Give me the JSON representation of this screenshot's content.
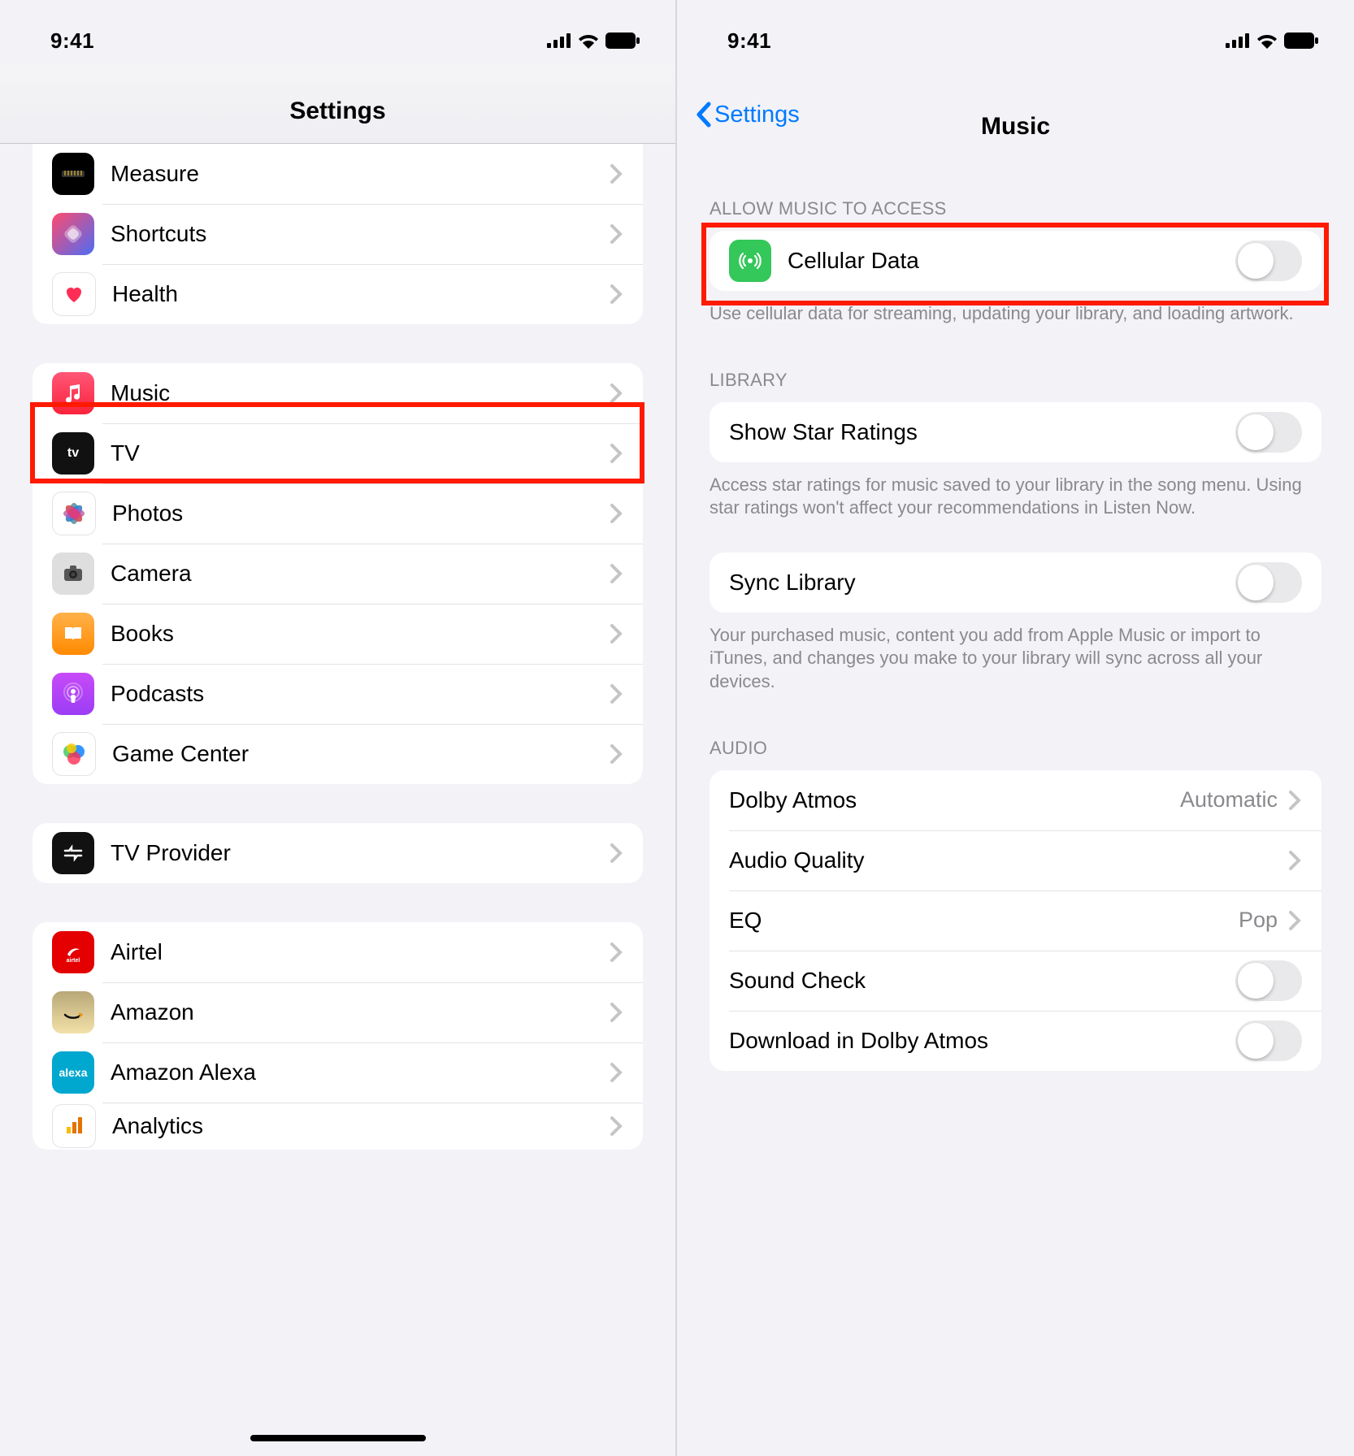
{
  "status": {
    "time": "9:41"
  },
  "left": {
    "title": "Settings",
    "group1": [
      {
        "id": "measure",
        "label": "Measure",
        "bg": "#111",
        "icon": "ruler"
      },
      {
        "id": "shortcuts",
        "label": "Shortcuts",
        "bg": "linear-gradient(135deg,#2a3fbf,#4d6cf5)",
        "icon": "shortcuts"
      },
      {
        "id": "health",
        "label": "Health",
        "bg": "#ffffff",
        "border": "#e3e3e6",
        "icon": "heart"
      }
    ],
    "group2": [
      {
        "id": "music",
        "label": "Music",
        "bg": "linear-gradient(#ff5777,#fa233b)",
        "icon": "music"
      },
      {
        "id": "tv",
        "label": "TV",
        "bg": "#111",
        "icon": "appletv"
      },
      {
        "id": "photos",
        "label": "Photos",
        "bg": "#ffffff",
        "border": "#e3e3e6",
        "icon": "photos"
      },
      {
        "id": "camera",
        "label": "Camera",
        "bg": "#9b9b9b",
        "icon": "camera"
      },
      {
        "id": "books",
        "label": "Books",
        "bg": "linear-gradient(#ffb14a,#ff8a00)",
        "icon": "books"
      },
      {
        "id": "podcasts",
        "label": "Podcasts",
        "bg": "linear-gradient(#c84af8,#9b3df5)",
        "icon": "podcasts"
      },
      {
        "id": "gamecenter",
        "label": "Game Center",
        "bg": "#ffffff",
        "border": "#e3e3e6",
        "icon": "gamecenter"
      }
    ],
    "group3": [
      {
        "id": "tvprovider",
        "label": "TV Provider",
        "bg": "#111",
        "icon": "tvprovider"
      }
    ],
    "group4": [
      {
        "id": "airtel",
        "label": "Airtel",
        "bg": "#e40000",
        "icon": "airtel"
      },
      {
        "id": "amazon",
        "label": "Amazon",
        "bg": "linear-gradient(#d9d0b0,#f7e7b4)",
        "icon": "amazon"
      },
      {
        "id": "alexa",
        "label": "Amazon Alexa",
        "bg": "#00a7ce",
        "icon": "alexa"
      },
      {
        "id": "analytics",
        "label": "Analytics",
        "bg": "#ffffff",
        "icon": "analytics"
      }
    ]
  },
  "right": {
    "back": "Settings",
    "title": "Music",
    "sections": {
      "access_header": "ALLOW MUSIC TO ACCESS",
      "cellular": {
        "label": "Cellular Data",
        "on": false
      },
      "cellular_footer": "Use cellular data for streaming, updating your library, and loading artwork.",
      "library_header": "LIBRARY",
      "star": {
        "label": "Show Star Ratings",
        "on": false
      },
      "star_footer": "Access star ratings for music saved to your library in the song menu. Using star ratings won't affect your recommendations in Listen Now.",
      "sync": {
        "label": "Sync Library",
        "on": false
      },
      "sync_footer": "Your purchased music, content you add from Apple Music or import to iTunes, and changes you make to your library will sync across all your devices.",
      "audio_header": "AUDIO",
      "dolby": {
        "label": "Dolby Atmos",
        "value": "Automatic"
      },
      "quality": {
        "label": "Audio Quality"
      },
      "eq": {
        "label": "EQ",
        "value": "Pop"
      },
      "soundcheck": {
        "label": "Sound Check",
        "on": false
      },
      "downloaddolby": {
        "label": "Download in Dolby Atmos",
        "on": false
      }
    }
  }
}
